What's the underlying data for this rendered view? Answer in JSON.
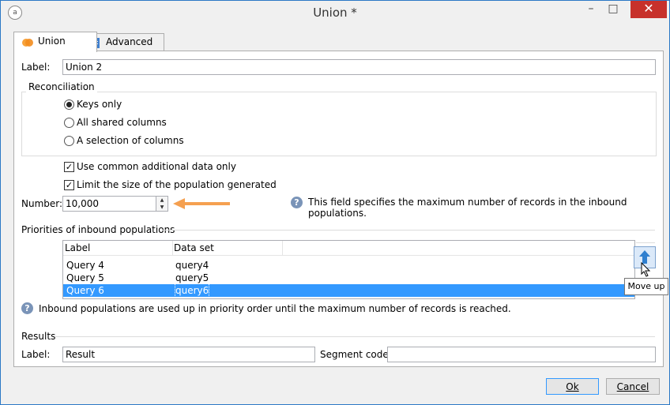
{
  "window": {
    "title": "Union *",
    "app_icon": "adobe-campaign-icon",
    "minimize_glyph": "–",
    "maximize_glyph": "□",
    "close_glyph": "✕"
  },
  "tabs": [
    {
      "label": "Union"
    },
    {
      "label": "Advanced"
    }
  ],
  "label_field": {
    "label": "Label:",
    "value": "Union 2"
  },
  "reconciliation": {
    "title": "Reconciliation",
    "options": [
      {
        "label": "Keys only"
      },
      {
        "label": "All shared columns"
      },
      {
        "label": "A selection of columns"
      }
    ],
    "selected": "Keys only"
  },
  "checks": {
    "use_common": {
      "label": "Use common additional data only",
      "checked": true
    },
    "limit_size": {
      "label": "Limit the size of the population generated",
      "checked": true
    }
  },
  "number_field": {
    "label": "Number:",
    "value": "10,000",
    "hint": "This field specifies the maximum number of records in the inbound populations."
  },
  "priorities": {
    "title": "Priorities of inbound populations",
    "columns": [
      "Label",
      "Data set"
    ],
    "rows": [
      {
        "label": "Query 4",
        "dataset": "query4"
      },
      {
        "label": "Query 5",
        "dataset": "query5"
      },
      {
        "label": "Query 6",
        "dataset": "query6"
      }
    ],
    "selected_row": "Query 6",
    "tooltip": "Move up",
    "note": "Inbound populations are used up in priority order until the maximum number of records is reached."
  },
  "results": {
    "title": "Results",
    "label_label": "Label:",
    "label_value": "Result",
    "segment_label": "Segment code:",
    "segment_value": ""
  },
  "buttons": {
    "ok": "Ok",
    "cancel": "Cancel"
  },
  "colors": {
    "accent": "#3399ff",
    "arrow": "#f5a050",
    "close": "#c7312b"
  }
}
